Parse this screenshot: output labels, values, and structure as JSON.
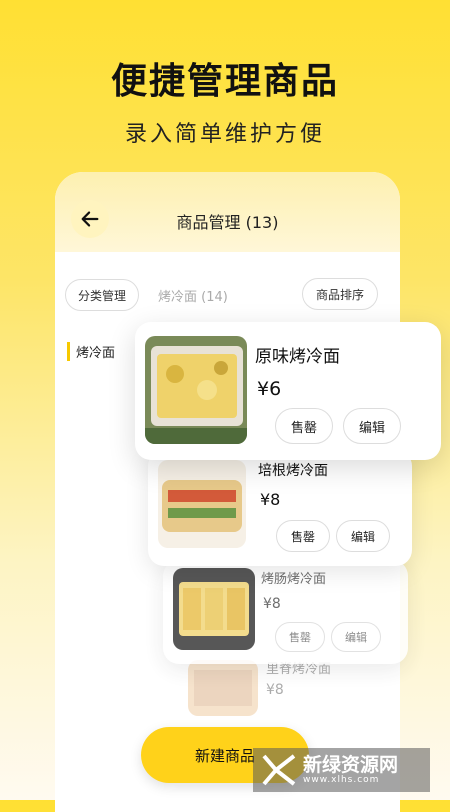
{
  "hero": {
    "title": "便捷管理商品",
    "subtitle": "录入简单维护方便"
  },
  "header": {
    "back_icon": "arrow-left-icon",
    "title": "商品管理 (13)"
  },
  "filters": {
    "category_manage": "分类管理",
    "current_category": "烤冷面 (14)",
    "sort": "商品排序"
  },
  "sidebar": {
    "items": [
      {
        "label": "烤冷面"
      }
    ]
  },
  "products": [
    {
      "name": "原味烤冷面",
      "price": "¥6",
      "sold_out": "售罄",
      "edit": "编辑"
    },
    {
      "name": "培根烤冷面",
      "price": "¥8",
      "sold_out": "售罄",
      "edit": "编辑"
    },
    {
      "name": "烤肠烤冷面",
      "price": "¥8",
      "sold_out": "售罄",
      "edit": "编辑"
    },
    {
      "name": "里脊烤冷面",
      "price": "¥8"
    }
  ],
  "fab": {
    "label": "新建商品"
  },
  "watermark": {
    "text": "新绿资源网",
    "url": "www.xlhs.com"
  },
  "colors": {
    "accent": "#ffd21a",
    "side_marker": "#f7c900"
  }
}
